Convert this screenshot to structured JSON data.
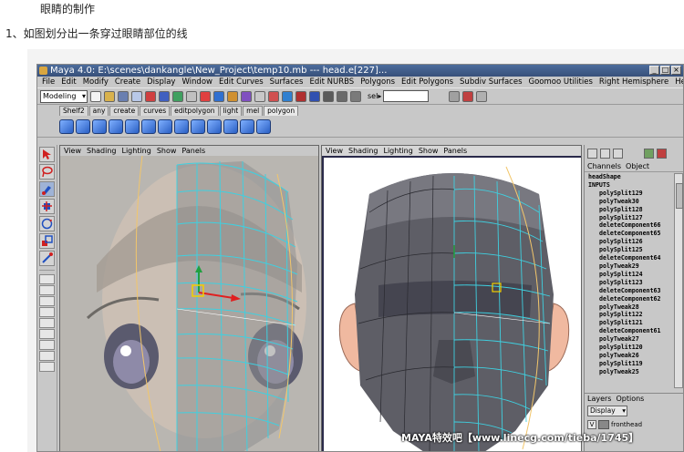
{
  "document": {
    "title": "眼睛的制作",
    "step": "1、如图划分出一条穿过眼睛部位的线"
  },
  "maya": {
    "title": "Maya 4.0: E:\\scenes\\dankangle\\New_Project\\temp10.mb  ---  head.e[227]...",
    "menu": [
      "File",
      "Edit",
      "Modify",
      "Create",
      "Display",
      "Window",
      "Edit Curves",
      "Surfaces",
      "Edit NURBS",
      "Polygons",
      "Edit Polygons",
      "Subdiv Surfaces",
      "Goomoo Utilities",
      "Right Hemisphere",
      "Help"
    ],
    "mode_select": "Modeling",
    "sel_label": "sel▸",
    "shelf_tabs": [
      "Shelf2",
      "any",
      "create",
      "curves",
      "editpolygon",
      "light",
      "mel",
      "polygon"
    ],
    "viewport_menu": [
      "View",
      "Shading",
      "Lighting",
      "Show",
      "Panels"
    ],
    "channel_tabs": [
      "Channels",
      "Object"
    ],
    "channel_shape": "headShape",
    "channel_inputs": "INPUTS",
    "history_nodes": [
      "polySplit129",
      "polyTweak30",
      "polySplit128",
      "polySplit127",
      "deleteComponent66",
      "deleteComponent65",
      "polySplit126",
      "polySplit125",
      "deleteComponent64",
      "polyTweak29",
      "polySplit124",
      "polySplit123",
      "deleteComponent63",
      "deleteComponent62",
      "polyTweak28",
      "polySplit122",
      "polySplit121",
      "deleteComponent61",
      "polyTweak27",
      "polySplit120",
      "polyTweak26",
      "polySplit119",
      "polyTweak25"
    ],
    "layers_tabs": [
      "Layers",
      "Options"
    ],
    "layers_display": "Display",
    "layer_visible": "V",
    "layer_name": "fronthead"
  },
  "watermark": "MAYA特效吧【www.linecg.com/tieba/1745】",
  "colors": {
    "title_bar": "#3f5d8c",
    "wire": "#3fd0e0",
    "selected_edge": "#f2c66b",
    "manip_red": "#e02020",
    "manip_green": "#20a040"
  }
}
